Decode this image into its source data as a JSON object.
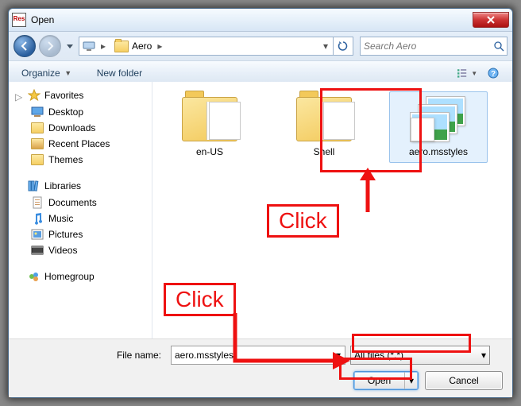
{
  "window": {
    "title": "Open"
  },
  "nav": {
    "breadcrumb_computer_icon": "computer-icon",
    "breadcrumb_folder": "Aero",
    "search_placeholder": "Search Aero"
  },
  "toolbar": {
    "organize": "Organize",
    "new_folder": "New folder"
  },
  "sidebar": {
    "favorites": {
      "label": "Favorites",
      "items": [
        {
          "label": "Desktop"
        },
        {
          "label": "Downloads"
        },
        {
          "label": "Recent Places"
        },
        {
          "label": "Themes"
        }
      ]
    },
    "libraries": {
      "label": "Libraries",
      "items": [
        {
          "label": "Documents"
        },
        {
          "label": "Music"
        },
        {
          "label": "Pictures"
        },
        {
          "label": "Videos"
        }
      ]
    },
    "homegroup": {
      "label": "Homegroup"
    }
  },
  "files": {
    "items": [
      {
        "label": "en-US",
        "kind": "folder",
        "selected": false
      },
      {
        "label": "Shell",
        "kind": "folder",
        "selected": false
      },
      {
        "label": "aero.msstyles",
        "kind": "msstyles",
        "selected": true
      }
    ]
  },
  "footer": {
    "filename_label": "File name:",
    "filename_value": "aero.msstyles",
    "filter_label": "All files (*.*)",
    "open_label": "Open",
    "cancel_label": "Cancel"
  },
  "annotations": {
    "click1": "Click",
    "click2": "Click"
  }
}
